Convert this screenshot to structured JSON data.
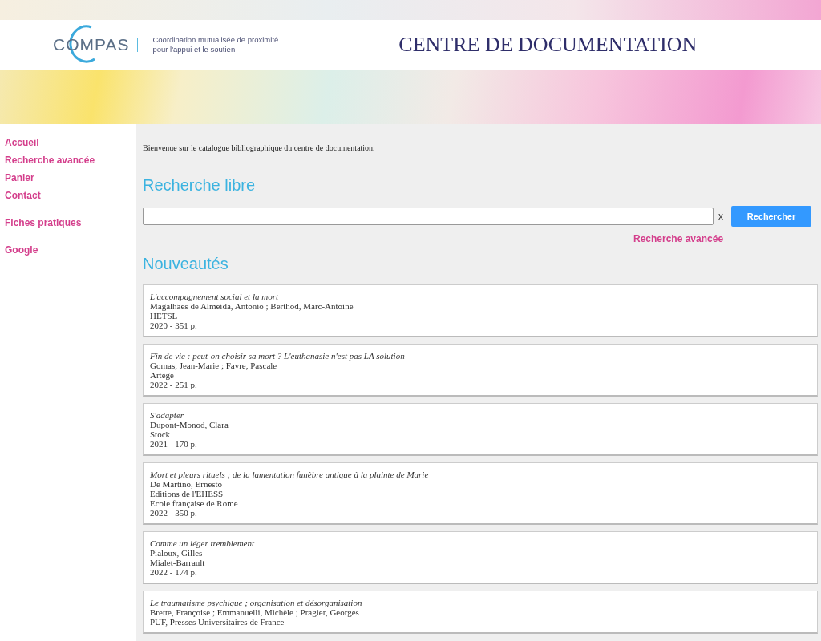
{
  "header": {
    "logo": "COMPAS",
    "tagline": [
      "Coordination mutualisée de proximité",
      "pour l'appui et le soutien"
    ],
    "title": "CENTRE DE DOCUMENTATION"
  },
  "sidebar": {
    "groups": [
      [
        "Accueil",
        "Recherche avancée",
        "Panier",
        "Contact"
      ],
      [
        "Fiches pratiques"
      ],
      [
        "Google"
      ]
    ]
  },
  "welcome": "Bienvenue sur le catalogue bibliographique du centre de documentation.",
  "search": {
    "heading": "Recherche libre",
    "clear": "x",
    "button": "Rechercher",
    "advanced_link": "Recherche avancée"
  },
  "news": {
    "heading": "Nouveautés",
    "items": [
      {
        "title": "L'accompagnement social et la mort",
        "details": [
          "Magalhães de Almeida, Antonio ; Berthod, Marc-Antoine",
          "HETSL",
          "2020 - 351 p."
        ]
      },
      {
        "title": "Fin de vie : peut-on choisir sa mort ? L'euthanasie n'est pas LA solution",
        "details": [
          "Gomas, Jean-Marie ; Favre, Pascale",
          "Artège",
          "2022 - 251 p."
        ]
      },
      {
        "title": "S'adapter",
        "details": [
          "Dupont-Monod, Clara",
          "Stock",
          "2021 - 170 p."
        ]
      },
      {
        "title": "Mort et pleurs rituels ; de la lamentation funèbre antique à la plainte de Marie",
        "details": [
          "De Martino, Ernesto",
          "Editions de l'EHESS",
          "Ecole française de Rome",
          "2022 - 350 p."
        ]
      },
      {
        "title": "Comme un léger tremblement",
        "details": [
          "Pialoux, Gilles",
          "Mialet-Barrault",
          "2022 - 174 p."
        ]
      },
      {
        "title": "Le traumatisme psychique ; organisation et désorganisation",
        "details": [
          "Brette, Françoise ; Emmanuelli, Michèle ; Pragier, Georges",
          "PUF, Presses Universitaires de France"
        ]
      }
    ]
  }
}
